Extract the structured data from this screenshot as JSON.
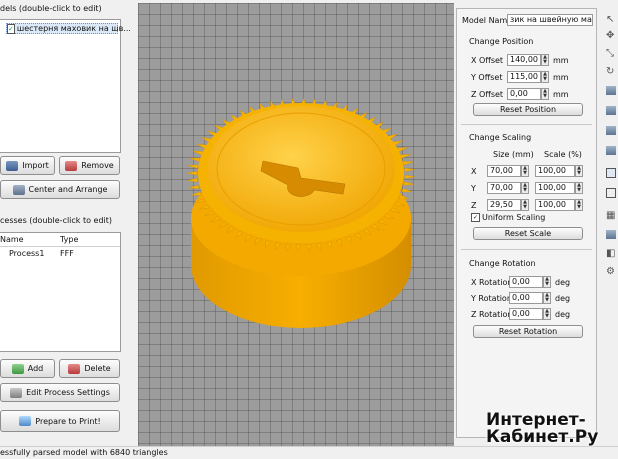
{
  "models_panel": {
    "title": "dels (double-click to edit)",
    "items": [
      {
        "label": "шестерня маховик на шв..."
      }
    ]
  },
  "buttons": {
    "import": "Import",
    "remove": "Remove",
    "center_arrange": "Center and Arrange",
    "add": "Add",
    "delete": "Delete",
    "edit_process": "Edit Process Settings",
    "prepare": "Prepare to Print!"
  },
  "processes_panel": {
    "title": "cesses (double-click to edit)",
    "columns": [
      "Name",
      "Type"
    ],
    "rows": [
      {
        "name": "Process1",
        "type": "FFF"
      }
    ]
  },
  "model": {
    "name_label": "Model Name:",
    "name_value": "зик на швейную машинку"
  },
  "position": {
    "title": "Change Position",
    "x_label": "X Offset",
    "x_value": "140,00",
    "y_label": "Y Offset",
    "y_value": "115,00",
    "z_label": "Z Offset",
    "z_value": "0,00",
    "unit": "mm",
    "reset": "Reset Position"
  },
  "scaling": {
    "title": "Change Scaling",
    "size_header": "Size (mm)",
    "scale_header": "Scale (%)",
    "rows": [
      {
        "axis": "X",
        "size": "70,00",
        "scale": "100,00"
      },
      {
        "axis": "Y",
        "size": "70,00",
        "scale": "100,00"
      },
      {
        "axis": "Z",
        "size": "29,50",
        "scale": "100,00"
      }
    ],
    "uniform_label": "Uniform Scaling",
    "reset": "Reset Scale"
  },
  "rotation": {
    "title": "Change Rotation",
    "x_label": "X Rotation",
    "x_value": "0,00",
    "y_label": "Y Rotation",
    "y_value": "0,00",
    "z_label": "Z Rotation",
    "z_value": "0,00",
    "unit": "deg",
    "reset": "Reset Rotation"
  },
  "status_text": "essfully parsed model with 6840 triangles",
  "watermark": {
    "line1": "Интернет-",
    "line2": "Кабинет.Ру"
  },
  "colors": {
    "model": "#f5a800",
    "viewport": "#9c9c9c",
    "panel": "#f0f0f0"
  }
}
